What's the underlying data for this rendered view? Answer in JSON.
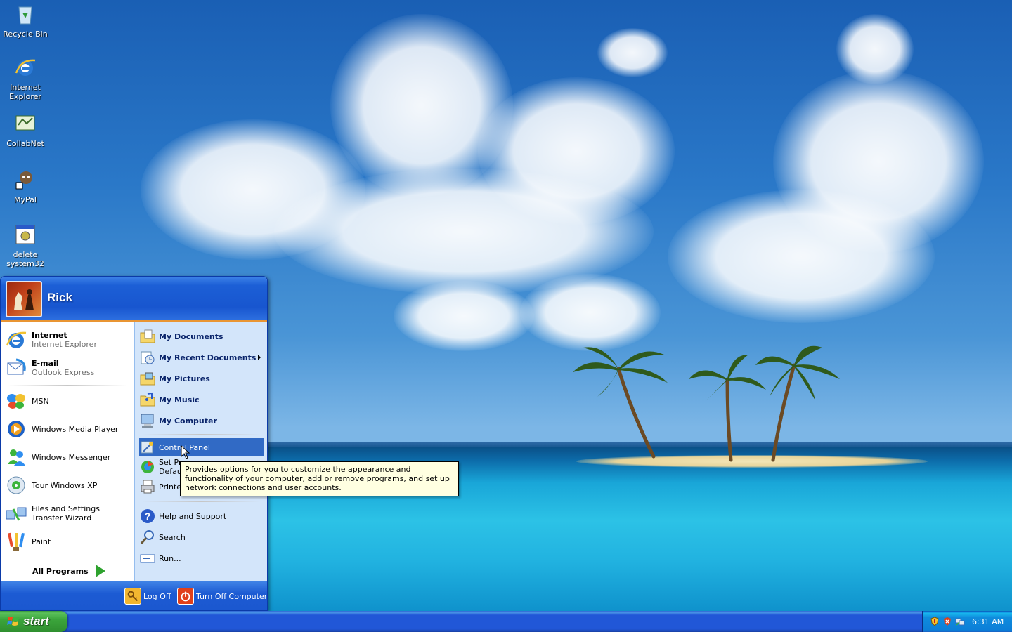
{
  "desktop": {
    "icons": [
      {
        "label": "Recycle Bin"
      },
      {
        "label": "Internet Explorer"
      },
      {
        "label": "CollabNet"
      },
      {
        "label": "MyPal"
      },
      {
        "label": "delete system32"
      }
    ]
  },
  "start_menu": {
    "username": "Rick",
    "pinned": [
      {
        "title": "Internet",
        "subtitle": "Internet Explorer"
      },
      {
        "title": "E-mail",
        "subtitle": "Outlook Express"
      }
    ],
    "recent": [
      {
        "label": "MSN"
      },
      {
        "label": "Windows Media Player"
      },
      {
        "label": "Windows Messenger"
      },
      {
        "label": "Tour Windows XP"
      },
      {
        "label": "Files and Settings Transfer Wizard"
      },
      {
        "label": "Paint"
      }
    ],
    "all_programs": "All Programs",
    "places": [
      {
        "label": "My Documents"
      },
      {
        "label": "My Recent Documents"
      },
      {
        "label": "My Pictures"
      },
      {
        "label": "My Music"
      },
      {
        "label": "My Computer"
      }
    ],
    "settings": [
      {
        "label": "Control Panel"
      },
      {
        "label": "Set Pr"
      },
      {
        "label": "Defau"
      },
      {
        "label": "Printer"
      }
    ],
    "help": [
      {
        "label": "Help and Support"
      },
      {
        "label": "Search"
      },
      {
        "label": "Run..."
      }
    ],
    "footer": {
      "log_off": "Log Off",
      "turn_off": "Turn Off Computer"
    }
  },
  "tooltip": {
    "text": "Provides options for you to customize the appearance and functionality of your computer, add or remove programs, and set up network connections and user accounts."
  },
  "taskbar": {
    "start_label": "start",
    "clock": "6:31 AM"
  },
  "colors": {
    "start_green": "#3ca53c",
    "taskbar_blue": "#2157d7",
    "selection_blue": "#316ac5",
    "tooltip_bg": "#ffffe1"
  }
}
